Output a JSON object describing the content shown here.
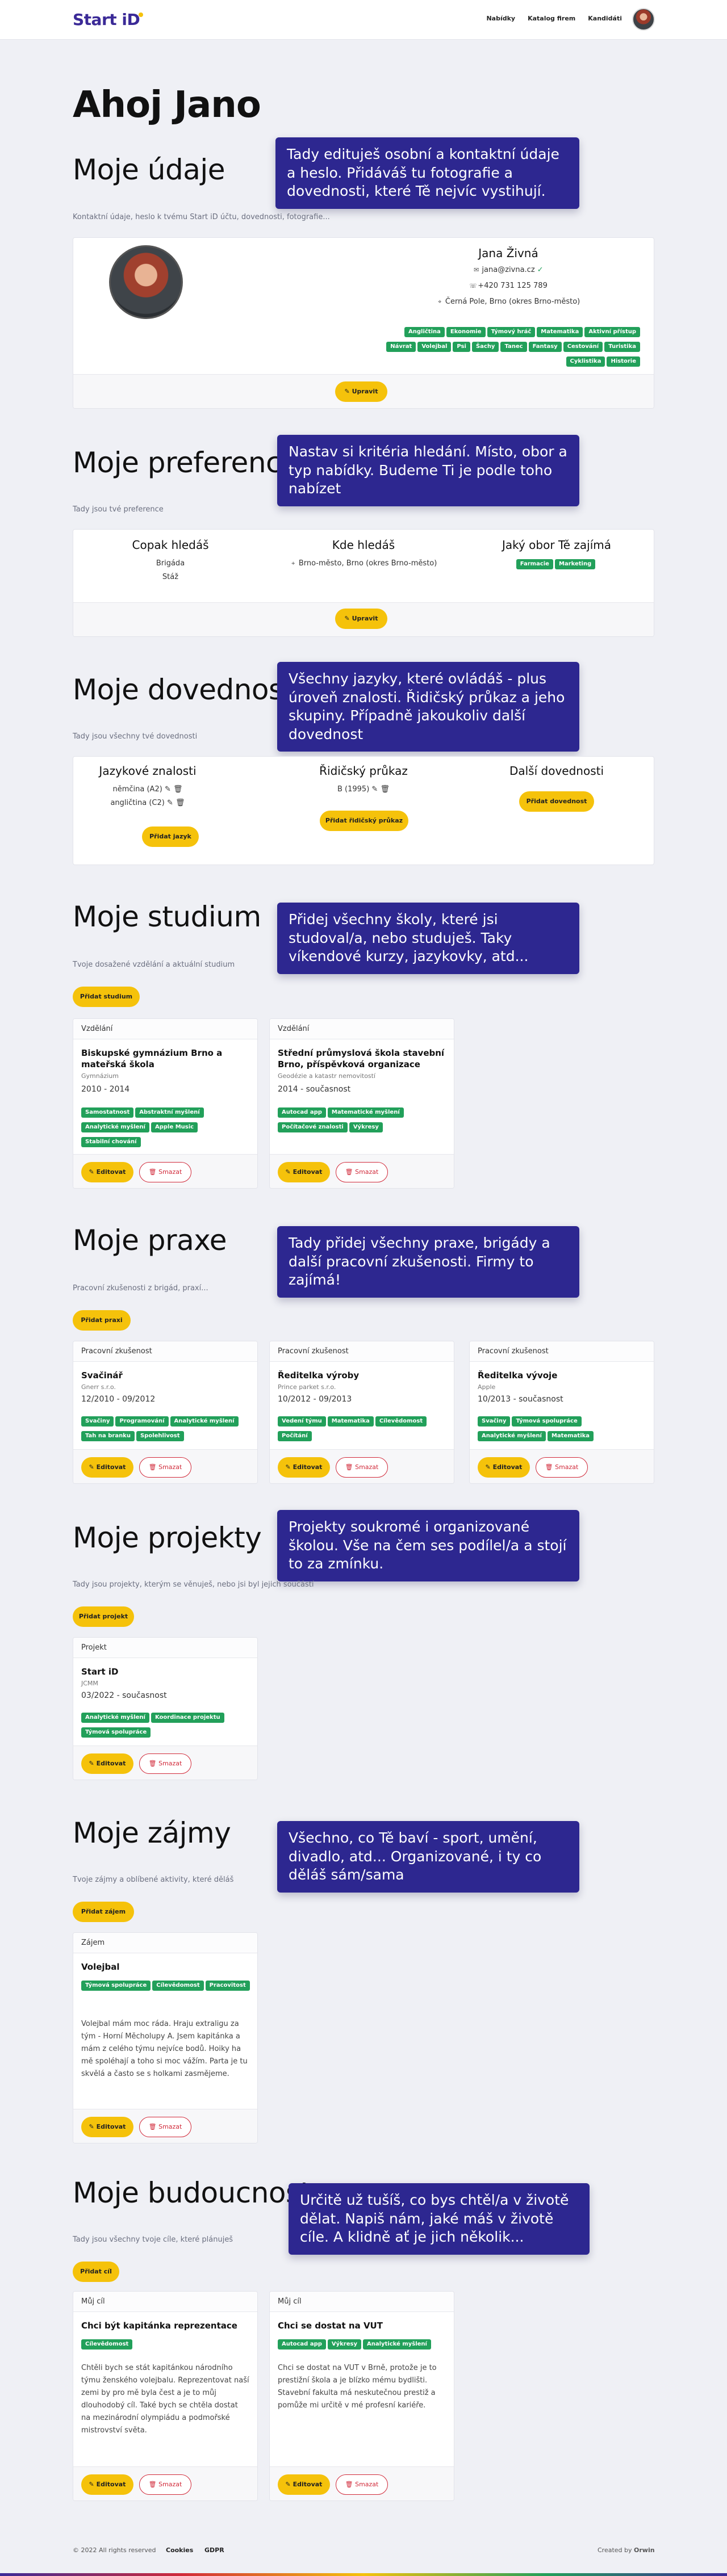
{
  "nav": {
    "brand": "Start iD",
    "links": [
      "Nabídky",
      "Katalog firem",
      "Kandidáti"
    ]
  },
  "greeting": "Ahoj Jano",
  "udaje": {
    "title": "Moje údaje",
    "callout": "Tady edituješ osobní a kontaktní údaje a heslo. Přidáváš tu fotografie a dovednosti, které Tě nejvíc vystihují.",
    "sub": "Kontaktní údaje, heslo k tvému Start iD účtu, dovednosti, fotografie...",
    "name": "Jana Živná",
    "email": "jana@zivna.cz",
    "phone": "+420 731 125 789",
    "address": "Černá Pole, Brno (okres Brno-město)",
    "tags": [
      "Angličtina",
      "Ekonomie",
      "Týmový hráč",
      "Matematika",
      "Aktivní přístup",
      "Návrat",
      "Volejbal",
      "Psi",
      "Šachy",
      "Tanec",
      "Fantasy",
      "Cestování",
      "Turistika",
      "Cyklistika",
      "Historie"
    ],
    "button": "Upravit"
  },
  "pref": {
    "title": "Moje preference",
    "callout": "Nastav si kritéria hledání. Místo, obor a typ nabídky. Budeme Ti je podle toho nabízet",
    "sub": "Tady jsou tvé preference",
    "col1_head": "Copak hledáš",
    "col1_vals": [
      "Brigáda",
      "Stáž"
    ],
    "col2_head": "Kde hledáš",
    "col2_val": "Brno-město, Brno (okres Brno-město)",
    "col3_head": "Jaký obor Tě zajímá",
    "col3_tags": [
      "Farmacie",
      "Marketing"
    ],
    "button": "Upravit"
  },
  "dov": {
    "title": "Moje dovednosti",
    "callout": "Všechny jazyky, které ovládáš - plus úroveň znalosti. Řidičský průkaz a jeho skupiny. Případně jakoukoliv další dovednost",
    "sub": "Tady jsou všechny tvé dovednosti",
    "col1_head": "Jazykové znalosti",
    "langs": [
      "němčina (A2)",
      "angličtina (C2)"
    ],
    "col1_btn": "Přidat jazyk",
    "col2_head": "Řidičský průkaz",
    "licence": "B (1995)",
    "col2_btn": "Přidat řidičský průkaz",
    "col3_head": "Další dovednosti",
    "col3_btn": "Přidat dovednost"
  },
  "stud": {
    "title": "Moje studium",
    "callout": "Přidej všechny školy, které jsi studoval/a, nebo studuješ. Taky víkendové kurzy, jazykovky, atd...",
    "sub": "Tvoje dosažené vzdělání a aktuální studium",
    "add": "Přidat studium",
    "cards": [
      {
        "head": "Vzdělání",
        "title": "Biskupské gymnázium Brno a mateřská škola",
        "small": "Gymnázium",
        "date": "2010 - 2014",
        "tags": [
          "Samostatnost",
          "Abstraktní myšlení",
          "Analytické myšlení",
          "Apple Music",
          "Stabilní chování"
        ]
      },
      {
        "head": "Vzdělání",
        "title": "Střední průmyslová škola stavební Brno, příspěvková organizace",
        "small": "Geodézie a katastr nemovitostí",
        "date": "2014 - současnost",
        "tags": [
          "Autocad app",
          "Matematické myšlení",
          "Počítačové znalosti",
          "Výkresy"
        ]
      }
    ],
    "edit": "Editovat",
    "del": "Smazat"
  },
  "praxe": {
    "title": "Moje praxe",
    "callout": "Tady přidej všechny praxe, brigády a další pracovní zkušenosti. Firmy to zajímá!",
    "sub": "Pracovní zkušenosti z brigád, praxí...",
    "add": "Přidat praxi",
    "cards": [
      {
        "head": "Pracovní zkušenost",
        "title": "Svačinář",
        "small": "Gnerr s.r.o.",
        "date": "12/2010 - 09/2012",
        "tags": [
          "Svačiny",
          "Programování",
          "Analytické myšlení",
          "Tah na branku",
          "Spolehlivost"
        ]
      },
      {
        "head": "Pracovní zkušenost",
        "title": "Ředitelka výroby",
        "small": "Prince parket s.r.o.",
        "date": "10/2012 - 09/2013",
        "tags": [
          "Vedení týmu",
          "Matematika",
          "Cílevědomost",
          "Počítání"
        ]
      },
      {
        "head": "Pracovní zkušenost",
        "title": "Ředitelka vývoje",
        "small": "Apple",
        "date": "10/2013 - současnost",
        "tags": [
          "Svačiny",
          "Týmová spolupráce",
          "Analytické myšlení",
          "Matematika"
        ]
      }
    ],
    "edit": "Editovat",
    "del": "Smazat"
  },
  "proj": {
    "title": "Moje projekty",
    "callout": "Projekty soukromé i organizované školou. Vše na čem ses podílel/a a stojí to za zmínku.",
    "sub": "Tady jsou projekty, kterým se věnuješ, nebo jsi byl jejich součástí",
    "add": "Přidat projekt",
    "card": {
      "head": "Projekt",
      "title": "Start iD",
      "small": "JCMM",
      "date": "03/2022 - současnost",
      "tags": [
        "Analytické myšlení",
        "Koordinace projektu",
        "Týmová spolupráce"
      ]
    },
    "edit": "Editovat",
    "del": "Smazat"
  },
  "zaj": {
    "title": "Moje zájmy",
    "callout": "Všechno, co Tě baví - sport, umění, divadlo, atd... Organizované, i ty co děláš sám/sama",
    "sub": "Tvoje zájmy a oblíbené aktivity, které děláš",
    "add": "Přidat zájem",
    "card": {
      "head": "Zájem",
      "title": "Volejbal",
      "tags": [
        "Týmová spolupráce",
        "Cílevědomost",
        "Pracovitost"
      ],
      "body": "Volejbal mám moc ráda. Hraju extraligu za tým - Horní Měcholupy A. Jsem kapitánka a mám z celého týmu nejvíce bodů. Hoiky ha mě spoléhají a toho si moc vážím. Parta je tu skvělá a často se s holkami zasmějeme."
    },
    "edit": "Editovat",
    "del": "Smazat"
  },
  "bud": {
    "title": "Moje budoucnost",
    "callout": "Určitě už tušíš, co bys chtěl/a v životě dělat. Napiš nám, jaké máš v životě cíle. A klidně ať je jich několik...",
    "sub": "Tady jsou všechny tvoje cíle, které plánuješ",
    "add": "Přidat cíl",
    "cards": [
      {
        "head": "Můj cíl",
        "title": "Chci být kapitánka reprezentace",
        "tags": [
          "Cílevědomost"
        ],
        "body": "Chtěli bych se stát kapitánkou národního týmu ženského volejbalu. Reprezentovat naší zemi by pro mě byla čest a je to můj dlouhodobý cíl. Také bych se chtěla dostat na mezinárodní olympiádu a podmořské mistrovství světa."
      },
      {
        "head": "Můj cíl",
        "title": "Chci se dostat na VUT",
        "tags": [
          "Autocad app",
          "Výkresy",
          "Analytické myšlení"
        ],
        "body": "Chci se dostat na VUT v Brně, protože je to prestižní škola a je blízko mému bydlišti. Stavební fakulta má neskutečnou prestiž a pomůže mi určitě v mé profesní kariéře."
      }
    ],
    "edit": "Editovat",
    "del": "Smazat"
  },
  "footer": {
    "copy": "© 2022 All rights reserved",
    "links": [
      "Cookies",
      "GDPR"
    ],
    "created": "Created by",
    "author": "Orwin"
  },
  "colors": {
    "brand": "#3b2a97",
    "accent": "#f5c20b",
    "tag": "#22a05a",
    "callout": "#2d2790",
    "danger": "#d12a3a"
  }
}
